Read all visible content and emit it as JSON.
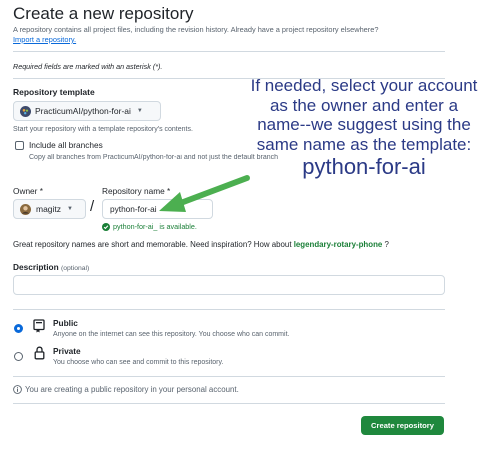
{
  "page": {
    "title": "Create a new repository",
    "subtitle": "A repository contains all project files, including the revision history. Already have a project repository elsewhere?",
    "import_link": "Import a repository.",
    "required_note": "Required fields are marked with an asterisk (*)."
  },
  "template": {
    "label": "Repository template",
    "selected": "PracticumAI/python-for-ai",
    "hint": "Start your repository with a template repository's contents.",
    "include_branches_label": "Include all branches",
    "include_branches_checked": false,
    "include_branches_hint": "Copy all branches from PracticumAI/python-for-ai and not just the default branch"
  },
  "owner": {
    "label": "Owner *",
    "value": "magitz"
  },
  "separator": "/",
  "repo_name": {
    "label": "Repository name *",
    "value": "python-for-ai",
    "available_msg": "python-for-ai_ is available."
  },
  "inspiration": {
    "text": "Great repository names are short and memorable. Need inspiration? How about",
    "suggestion": "legendary-rotary-phone",
    "suffix": "?"
  },
  "description": {
    "label": "Description",
    "optional": "(optional)",
    "value": ""
  },
  "visibility": {
    "selected": "Public",
    "options": [
      {
        "label": "Public",
        "desc": "Anyone on the internet can see this repository. You choose who can commit."
      },
      {
        "label": "Private",
        "desc": "You choose who can see and commit to this repository."
      }
    ]
  },
  "info_note": "You are creating a public repository in your personal account.",
  "create_button": "Create repository",
  "annotation": {
    "line1": "If needed, select your account",
    "line2": "as the owner and enter a",
    "line3": "name--we suggest using the",
    "line4": "same name as the template:",
    "line5": "python-for-ai"
  },
  "colors": {
    "primary_green": "#1f883d",
    "link_blue": "#0969da",
    "annotation_text": "#2b3a86",
    "arrow_green": "#4caf50"
  }
}
